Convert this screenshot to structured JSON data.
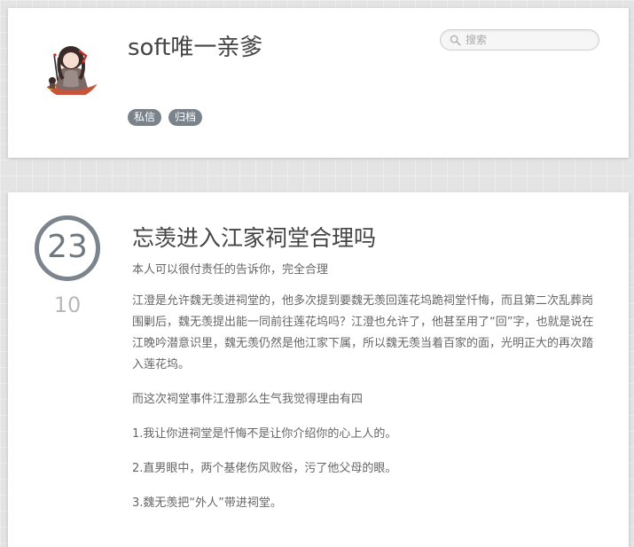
{
  "header": {
    "blog_title": "soft唯一亲爹",
    "search_placeholder": "搜索",
    "nav": [
      {
        "label": "私信"
      },
      {
        "label": "归档"
      }
    ]
  },
  "post": {
    "day": "23",
    "month": "10",
    "title": "忘羡进入江家祠堂合理吗",
    "subtitle": "本人可以很付责任的告诉你，完全合理",
    "paragraphs": [
      "江澄是允许魏无羡进祠堂的，他多次提到要魏无羡回莲花坞跪祠堂忏悔，而且第二次乱葬岗围剿后，魏无羡提出能一同前往莲花坞吗？江澄也允许了，他甚至用了“回”字，也就是说在江晚吟潜意识里，魏无羡仍然是他江家下属，所以魏无羡当着百家的面，光明正大的再次踏入莲花坞。",
      "而这次祠堂事件江澄那么生气我觉得理由有四",
      "1.我让你进祠堂是忏悔不是让你介绍你的心上人的。",
      "2.直男眼中，两个基佬伤风败俗，污了他父母的眼。",
      "3.魏无羡把“外人”带进祠堂。"
    ]
  },
  "colors": {
    "tag_bg": "#7a838b",
    "date_ring": "#7c858d",
    "month_text": "#b9b9b9"
  }
}
